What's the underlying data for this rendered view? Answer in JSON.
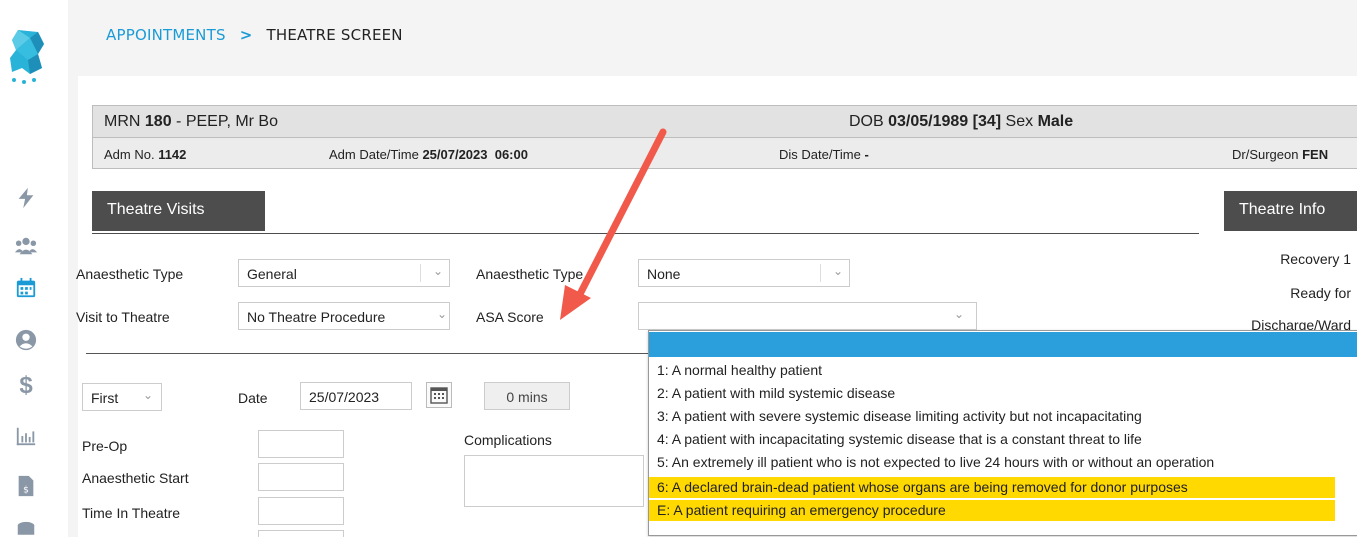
{
  "breadcrumb": {
    "parent": "APPOINTMENTS",
    "separator": ">",
    "current": "THEATRE SCREEN"
  },
  "patient": {
    "mrn_label": "MRN ",
    "mrn": "180",
    "name": " - PEEP, Mr Bo",
    "dob_label": "DOB ",
    "dob": "03/05/1989 [34]",
    "sex_label": " Sex ",
    "sex": "Male",
    "adm_no_label": "Adm No. ",
    "adm_no": "1142",
    "adm_dt_label": "Adm Date/Time ",
    "adm_dt": "25/07/2023  06:00",
    "dis_dt_label": "Dis Date/Time ",
    "dis_dt": "-",
    "surgeon_label": "Dr/Surgeon ",
    "surgeon": "FEN"
  },
  "tabs": {
    "visits": "Theatre Visits",
    "info": "Theatre Info"
  },
  "form": {
    "anaesthetic_type_label": "Anaesthetic Type",
    "anaesthetic_type": "General",
    "anaesthetic_type2_label": "Anaesthetic Type",
    "anaesthetic_type2": "None",
    "visit_label": "Visit to Theatre",
    "visit": "No Theatre Procedure",
    "asa_label": "ASA Score",
    "asa": "",
    "order": "First",
    "date_label": "Date",
    "date": "25/07/2023",
    "duration": "0 mins",
    "preop_label": "Pre-Op",
    "anaesthetic_start_label": "Anaesthetic Start",
    "time_in_theatre_label": "Time In Theatre",
    "complications_label": "Complications"
  },
  "right_panel": {
    "recovery": "Recovery 1",
    "ready": "Ready for",
    "discharge": "Discharge/Ward"
  },
  "asa_options": [
    "",
    "1: A normal healthy patient",
    "2: A patient with mild systemic disease",
    "3: A patient with severe systemic disease limiting activity but not incapacitating",
    "4: A patient with incapacitating systemic disease that is a constant threat to life",
    "5: An extremely ill patient who is not expected to live 24 hours with or without an operation",
    "6: A declared brain-dead patient whose organs are being removed for donor purposes",
    "E: A patient requiring an emergency procedure"
  ],
  "colors": {
    "accent": "#1b9bd6",
    "highlight": "#ffd900",
    "selected": "#2a9fdb",
    "annotation_arrow": "#f15a4a"
  },
  "icons": [
    "logo",
    "bolt-icon",
    "users-icon",
    "calendar-icon",
    "user-circle-icon",
    "dollar-icon",
    "chart-icon",
    "invoice-icon",
    "database-icon"
  ]
}
